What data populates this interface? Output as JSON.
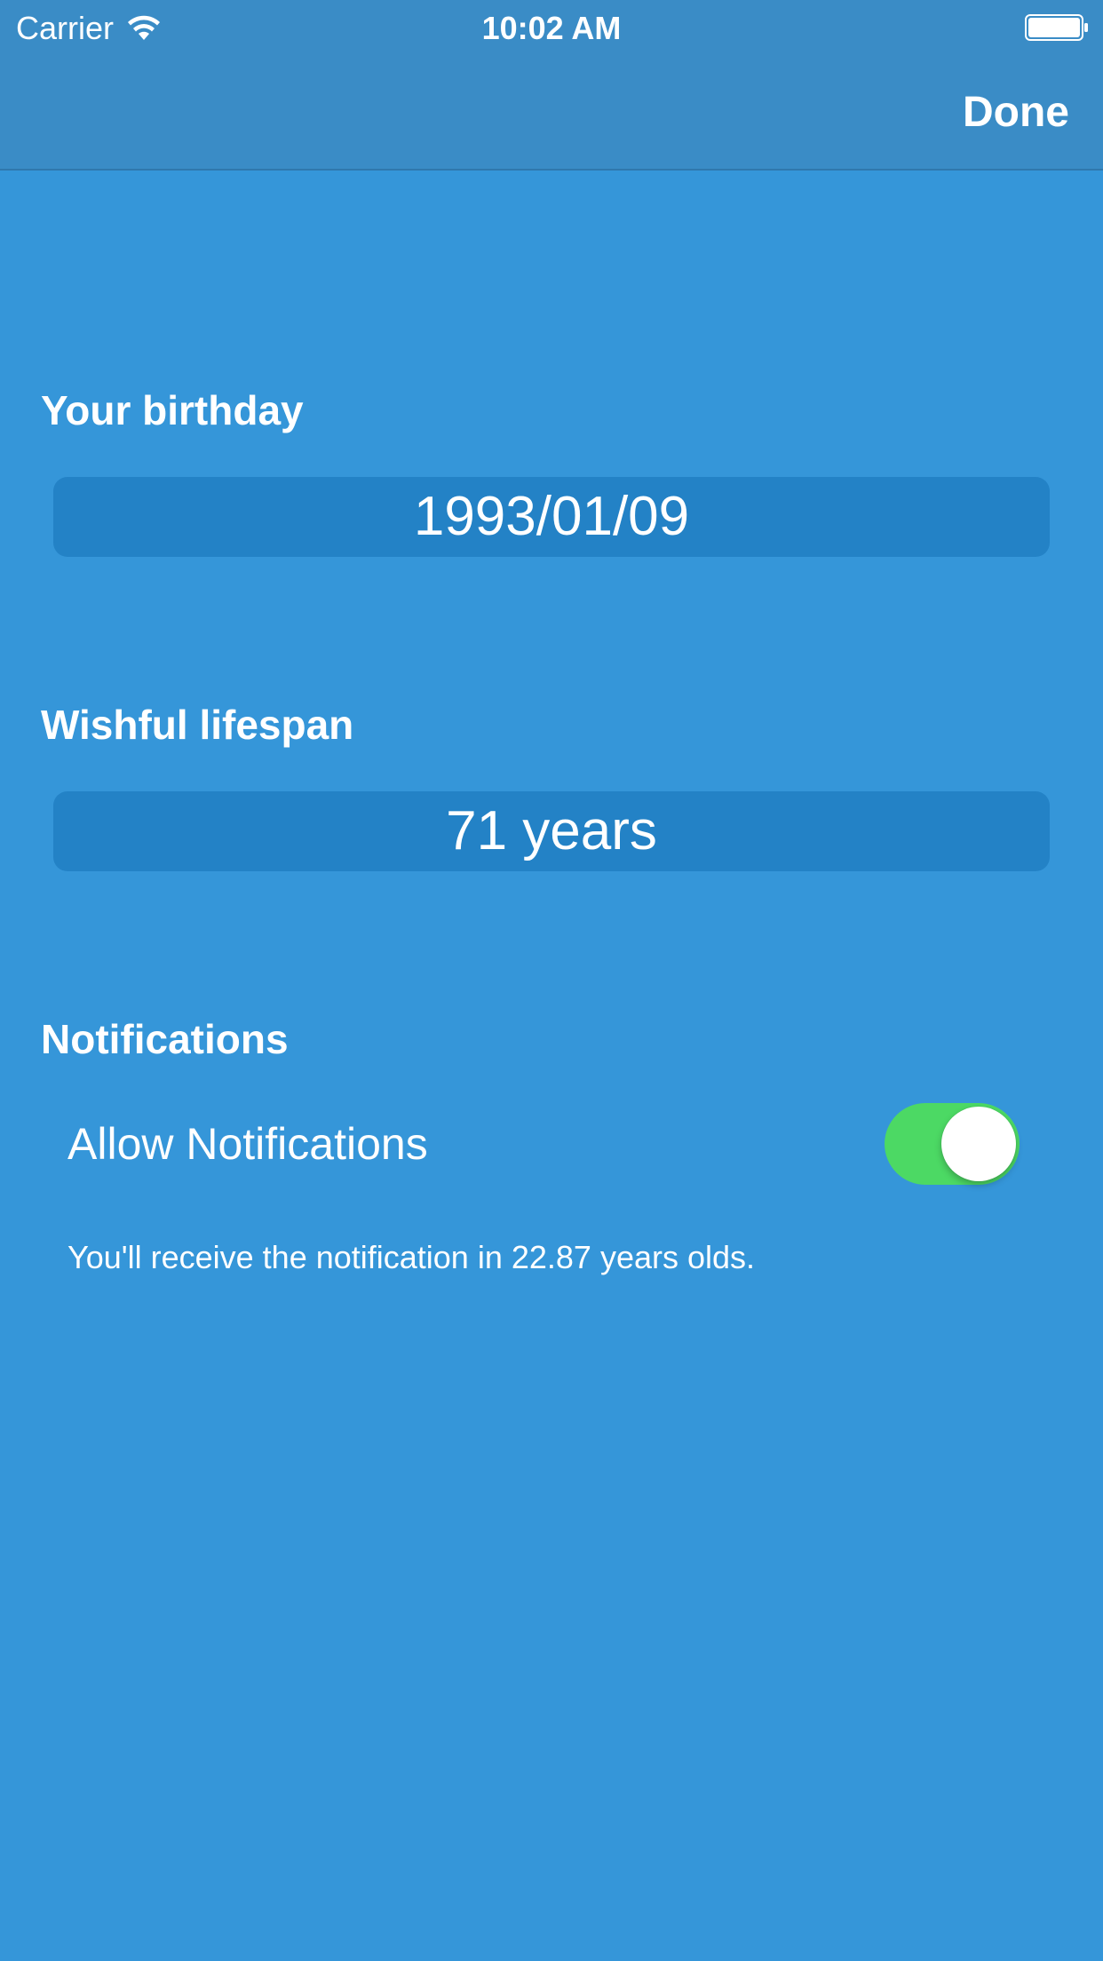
{
  "status_bar": {
    "carrier": "Carrier",
    "time": "10:02 AM",
    "wifi_icon": "wifi-icon",
    "battery_icon": "battery-icon"
  },
  "nav_bar": {
    "done_label": "Done"
  },
  "birthday": {
    "label": "Your birthday",
    "value": "1993/01/09"
  },
  "lifespan": {
    "label": "Wishful lifespan",
    "value": "71 years"
  },
  "notifications": {
    "section_label": "Notifications",
    "allow_label": "Allow Notifications",
    "allow_enabled": true,
    "note": "You'll receive the notification in 22.87 years olds."
  },
  "colors": {
    "background": "#3596d9",
    "nav_bar": "#3a8cc6",
    "field": "#2382c6",
    "toggle_on": "#4cd964",
    "text": "#ffffff"
  }
}
